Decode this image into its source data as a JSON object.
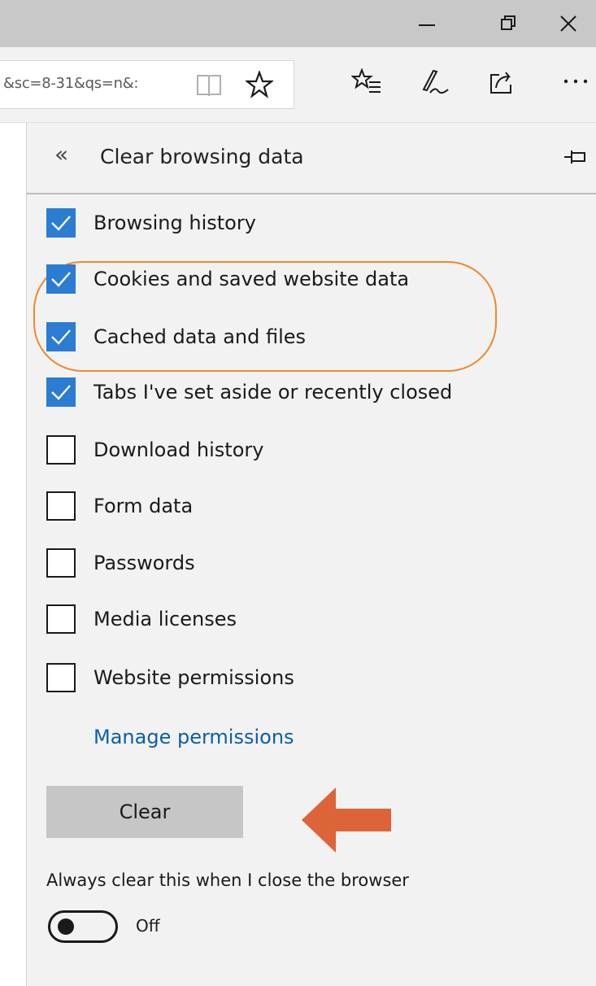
{
  "window": {
    "controls": [
      "minimize-icon",
      "restore-icon",
      "close-icon"
    ]
  },
  "toolbar": {
    "url_fragment": "&sc=8-31&qs=n&:",
    "icons": [
      "reading-view-icon",
      "favorite-star-icon",
      "favorites-hub-icon",
      "web-note-icon",
      "share-icon",
      "more-icon"
    ]
  },
  "panel": {
    "title": "Clear browsing data",
    "back_icon": "double-chevron-left-icon",
    "pin_icon": "pin-icon",
    "options": [
      {
        "label": "Browsing history",
        "checked": true
      },
      {
        "label": "Cookies and saved website data",
        "checked": true
      },
      {
        "label": "Cached data and files",
        "checked": true
      },
      {
        "label": "Tabs I've set aside or recently closed",
        "checked": true
      },
      {
        "label": "Download history",
        "checked": false
      },
      {
        "label": "Form data",
        "checked": false
      },
      {
        "label": "Passwords",
        "checked": false
      },
      {
        "label": "Media licenses",
        "checked": false
      },
      {
        "label": "Website permissions",
        "checked": false
      }
    ],
    "manage_link": "Manage permissions",
    "clear_button": "Clear",
    "always_clear_label": "Always clear this when I close the browser",
    "toggle_state": "Off",
    "toggle_on": false
  },
  "annotations": {
    "highlight_color": "#f0882a",
    "arrow_color": "#dc6438"
  },
  "colors": {
    "accent": "#2b7cd3",
    "link": "#0d5ea8"
  }
}
